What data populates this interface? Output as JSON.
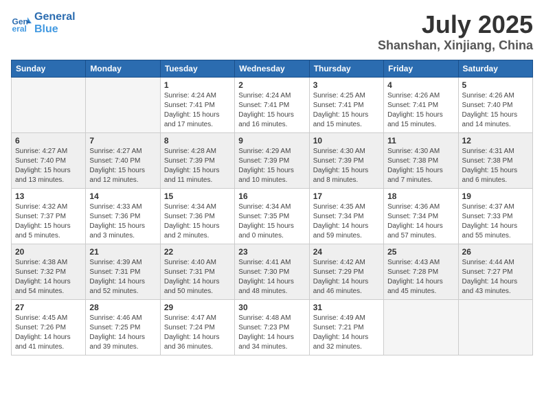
{
  "header": {
    "logo_line1": "General",
    "logo_line2": "Blue",
    "month": "July 2025",
    "location": "Shanshan, Xinjiang, China"
  },
  "days_of_week": [
    "Sunday",
    "Monday",
    "Tuesday",
    "Wednesday",
    "Thursday",
    "Friday",
    "Saturday"
  ],
  "weeks": [
    [
      {
        "day": "",
        "info": ""
      },
      {
        "day": "",
        "info": ""
      },
      {
        "day": "1",
        "info": "Sunrise: 4:24 AM\nSunset: 7:41 PM\nDaylight: 15 hours and 17 minutes."
      },
      {
        "day": "2",
        "info": "Sunrise: 4:24 AM\nSunset: 7:41 PM\nDaylight: 15 hours and 16 minutes."
      },
      {
        "day": "3",
        "info": "Sunrise: 4:25 AM\nSunset: 7:41 PM\nDaylight: 15 hours and 15 minutes."
      },
      {
        "day": "4",
        "info": "Sunrise: 4:26 AM\nSunset: 7:41 PM\nDaylight: 15 hours and 15 minutes."
      },
      {
        "day": "5",
        "info": "Sunrise: 4:26 AM\nSunset: 7:40 PM\nDaylight: 15 hours and 14 minutes."
      }
    ],
    [
      {
        "day": "6",
        "info": "Sunrise: 4:27 AM\nSunset: 7:40 PM\nDaylight: 15 hours and 13 minutes."
      },
      {
        "day": "7",
        "info": "Sunrise: 4:27 AM\nSunset: 7:40 PM\nDaylight: 15 hours and 12 minutes."
      },
      {
        "day": "8",
        "info": "Sunrise: 4:28 AM\nSunset: 7:39 PM\nDaylight: 15 hours and 11 minutes."
      },
      {
        "day": "9",
        "info": "Sunrise: 4:29 AM\nSunset: 7:39 PM\nDaylight: 15 hours and 10 minutes."
      },
      {
        "day": "10",
        "info": "Sunrise: 4:30 AM\nSunset: 7:39 PM\nDaylight: 15 hours and 8 minutes."
      },
      {
        "day": "11",
        "info": "Sunrise: 4:30 AM\nSunset: 7:38 PM\nDaylight: 15 hours and 7 minutes."
      },
      {
        "day": "12",
        "info": "Sunrise: 4:31 AM\nSunset: 7:38 PM\nDaylight: 15 hours and 6 minutes."
      }
    ],
    [
      {
        "day": "13",
        "info": "Sunrise: 4:32 AM\nSunset: 7:37 PM\nDaylight: 15 hours and 5 minutes."
      },
      {
        "day": "14",
        "info": "Sunrise: 4:33 AM\nSunset: 7:36 PM\nDaylight: 15 hours and 3 minutes."
      },
      {
        "day": "15",
        "info": "Sunrise: 4:34 AM\nSunset: 7:36 PM\nDaylight: 15 hours and 2 minutes."
      },
      {
        "day": "16",
        "info": "Sunrise: 4:34 AM\nSunset: 7:35 PM\nDaylight: 15 hours and 0 minutes."
      },
      {
        "day": "17",
        "info": "Sunrise: 4:35 AM\nSunset: 7:34 PM\nDaylight: 14 hours and 59 minutes."
      },
      {
        "day": "18",
        "info": "Sunrise: 4:36 AM\nSunset: 7:34 PM\nDaylight: 14 hours and 57 minutes."
      },
      {
        "day": "19",
        "info": "Sunrise: 4:37 AM\nSunset: 7:33 PM\nDaylight: 14 hours and 55 minutes."
      }
    ],
    [
      {
        "day": "20",
        "info": "Sunrise: 4:38 AM\nSunset: 7:32 PM\nDaylight: 14 hours and 54 minutes."
      },
      {
        "day": "21",
        "info": "Sunrise: 4:39 AM\nSunset: 7:31 PM\nDaylight: 14 hours and 52 minutes."
      },
      {
        "day": "22",
        "info": "Sunrise: 4:40 AM\nSunset: 7:31 PM\nDaylight: 14 hours and 50 minutes."
      },
      {
        "day": "23",
        "info": "Sunrise: 4:41 AM\nSunset: 7:30 PM\nDaylight: 14 hours and 48 minutes."
      },
      {
        "day": "24",
        "info": "Sunrise: 4:42 AM\nSunset: 7:29 PM\nDaylight: 14 hours and 46 minutes."
      },
      {
        "day": "25",
        "info": "Sunrise: 4:43 AM\nSunset: 7:28 PM\nDaylight: 14 hours and 45 minutes."
      },
      {
        "day": "26",
        "info": "Sunrise: 4:44 AM\nSunset: 7:27 PM\nDaylight: 14 hours and 43 minutes."
      }
    ],
    [
      {
        "day": "27",
        "info": "Sunrise: 4:45 AM\nSunset: 7:26 PM\nDaylight: 14 hours and 41 minutes."
      },
      {
        "day": "28",
        "info": "Sunrise: 4:46 AM\nSunset: 7:25 PM\nDaylight: 14 hours and 39 minutes."
      },
      {
        "day": "29",
        "info": "Sunrise: 4:47 AM\nSunset: 7:24 PM\nDaylight: 14 hours and 36 minutes."
      },
      {
        "day": "30",
        "info": "Sunrise: 4:48 AM\nSunset: 7:23 PM\nDaylight: 14 hours and 34 minutes."
      },
      {
        "day": "31",
        "info": "Sunrise: 4:49 AM\nSunset: 7:21 PM\nDaylight: 14 hours and 32 minutes."
      },
      {
        "day": "",
        "info": ""
      },
      {
        "day": "",
        "info": ""
      }
    ]
  ]
}
